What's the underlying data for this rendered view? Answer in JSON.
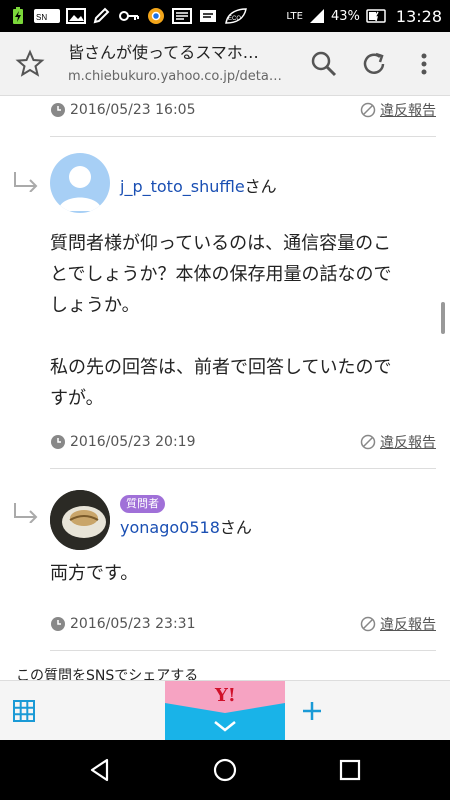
{
  "status_bar": {
    "left_icons": [
      "charging-icon",
      "smartnews-icon",
      "photo-icon",
      "edit-icon",
      "key-icon",
      "chrome-icon",
      "news-icon",
      "cast-icon",
      "eco-icon"
    ],
    "eco_label": "ECO",
    "network": "LTE",
    "battery_percent": "43%",
    "time": "13:28"
  },
  "browser": {
    "page_title": "皆さんが使ってるスマホ…",
    "url": "m.chiebukuro.yahoo.co.jp/deta…"
  },
  "answers": [
    {
      "date": "2016/05/23 16:05",
      "report_label": "違反報告"
    },
    {
      "username": "j_p_toto_shuffle",
      "suffix": "さん",
      "body_lines": [
        "質問者様が仰っているのは、通信容量のこ",
        "とでしょうか？本体の保存用量の話なので",
        "しょうか。",
        "",
        "私の先の回答は、前者で回答していたので",
        "すが。"
      ],
      "date": "2016/05/23 20:19",
      "report_label": "違反報告"
    },
    {
      "badge": "質問者",
      "username": "yonago0518",
      "suffix": "さん",
      "body_lines": [
        "両方です。"
      ],
      "date": "2016/05/23 23:31",
      "report_label": "違反報告"
    }
  ],
  "share": {
    "label": "この質問をSNSでシェアする"
  },
  "bottom_bar": {
    "center_logo": "Y!",
    "colors": {
      "accent_blue": "#19b3e8",
      "accent_pink": "#f6a3c2"
    }
  },
  "nav_bar": {
    "buttons": [
      "back",
      "home",
      "recents"
    ]
  }
}
